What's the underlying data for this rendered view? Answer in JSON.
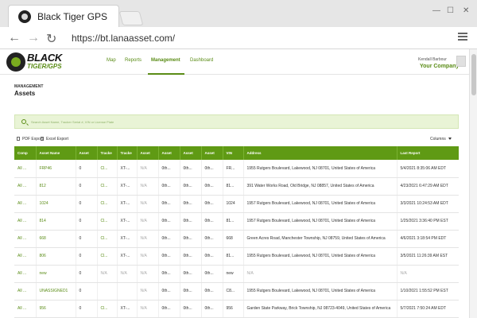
{
  "browser": {
    "tab_title": "Black Tiger GPS",
    "url": "https://bt.lanaasset.com/"
  },
  "header": {
    "brand_line1": "BLACK",
    "brand_line2": "TIGER/GPS",
    "nav": {
      "map": "Map",
      "reports": "Reports",
      "management": "Management",
      "dashboard": "Dashboard"
    },
    "user_name": "Kendall Barbour",
    "company": "Your Company"
  },
  "page": {
    "breadcrumb": "MANAGEMENT",
    "title": "Assets",
    "search_placeholder": "Search Asset Name, Tracker Serial #, VIN or License Plate",
    "pdf_export": "PDF Export",
    "excel_export": "Excel Export",
    "columns": "Columns"
  },
  "table": {
    "headers": [
      "Comp",
      "Asset Name",
      "Asset",
      "Tracke",
      "Tracke",
      "Asset",
      "Asset",
      "Asset",
      "Asset",
      "VIN",
      "Address",
      "Last Report"
    ],
    "rows": [
      [
        "All ...",
        "FRP46",
        "0",
        "Cl...",
        "XT-...",
        "N/A",
        "0th...",
        "0th...",
        "0th...",
        "FR...",
        "1955 Rutgers Boulevard, Lakewood, NJ 08701, United States of America",
        "5/4/2021 8:35:06 AM EDT"
      ],
      [
        "All ...",
        "812",
        "0",
        "Cl...",
        "XT-...",
        "N/A",
        "0th...",
        "0th...",
        "0th...",
        "81...",
        "391 Water Works Road, Old Bridge, NJ 08857, United States of America",
        "4/23/2021 6:47:29 AM EDT"
      ],
      [
        "All ...",
        "1024",
        "0",
        "Cl...",
        "XT-...",
        "N/A",
        "0th...",
        "0th...",
        "0th...",
        "1024",
        "1957 Rutgers Boulevard, Lakewood, NJ 08701, United States of America",
        "3/3/2021 10:24:53 AM EDT"
      ],
      [
        "All ...",
        "814",
        "0",
        "Cl...",
        "XT-...",
        "N/A",
        "0th...",
        "0th...",
        "0th...",
        "81...",
        "1957 Rutgers Boulevard, Lakewood, NJ 08701, United States of America",
        "1/25/2021 3:36:40 PM EST"
      ],
      [
        "All ...",
        "668",
        "0",
        "Cl...",
        "XT-...",
        "N/A",
        "0th...",
        "0th...",
        "0th...",
        "668",
        "Green Acres Road, Manchester Township, NJ 08759, United States of America",
        "4/6/2021 3:18:54 PM EDT"
      ],
      [
        "All ...",
        "806",
        "0",
        "Cl...",
        "XT-...",
        "N/A",
        "0th...",
        "0th...",
        "0th...",
        "81...",
        "1955 Rutgers Boulevard, Lakewood, NJ 08701, United States of America",
        "3/5/2021 11:26:39 AM EST"
      ],
      [
        "All ...",
        "new",
        "0",
        "N/A",
        "N/A",
        "N/A",
        "0th...",
        "0th...",
        "0th...",
        "new",
        "N/A",
        "N/A"
      ],
      [
        "All ...",
        "UNASSIGNED1",
        "0",
        "",
        "",
        "N/A",
        "0th...",
        "0th...",
        "0th...",
        "C8...",
        "1955 Rutgers Boulevard, Lakewood, NJ 08701, United States of America",
        "1/10/2021 1:55:52 PM EST"
      ],
      [
        "All ...",
        "956",
        "0",
        "Cl...",
        "XT-...",
        "N/A",
        "0th...",
        "0th...",
        "0th...",
        "956",
        "Garden State Parkway, Brick Township, NJ 08723-4049, United States of America",
        "5/7/2021 7:50:24 AM EDT"
      ]
    ]
  }
}
